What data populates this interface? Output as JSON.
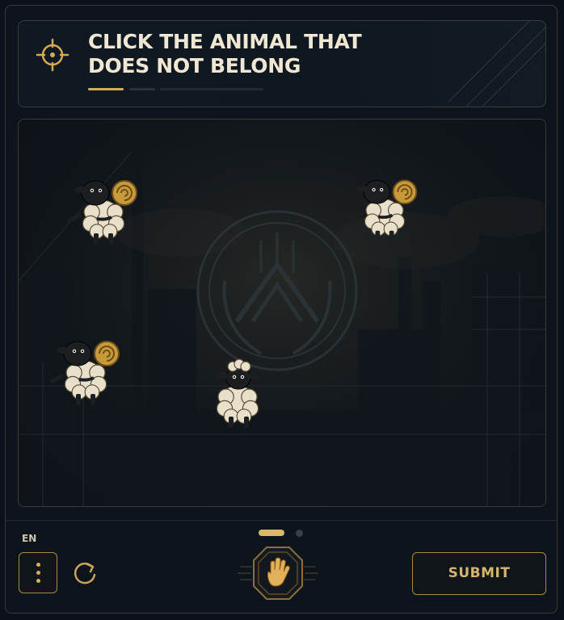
{
  "header": {
    "title_line1": "CLICK THE ANIMAL THAT",
    "title_line2": "DOES NOT BELONG",
    "icon": "crosshair-target-icon",
    "progress_segments": [
      {
        "state": "active",
        "color": "#d5aa55"
      },
      {
        "state": "inactive",
        "color": "#2c3338"
      },
      {
        "state": "inactive",
        "color": "#232a30"
      }
    ]
  },
  "stage": {
    "background": "industrial-factory-scene",
    "emblem": "circular-wreath-emblem",
    "animals": [
      {
        "id": "animal-1",
        "kind": "ram"
      },
      {
        "id": "animal-2",
        "kind": "ram"
      },
      {
        "id": "animal-3",
        "kind": "ram"
      },
      {
        "id": "animal-4",
        "kind": "sheep"
      }
    ]
  },
  "footer": {
    "language": "EN",
    "menu_icon": "vertical-dots-icon",
    "reload_icon": "reload-icon",
    "pager": {
      "pages": 2,
      "current": 1
    },
    "badge_icon": "hand-icon",
    "submit_label": "SUBMIT"
  },
  "colors": {
    "accent": "#d7b56a",
    "border": "#a88a48",
    "background": "#0d141c",
    "title": "#efe7d4"
  }
}
